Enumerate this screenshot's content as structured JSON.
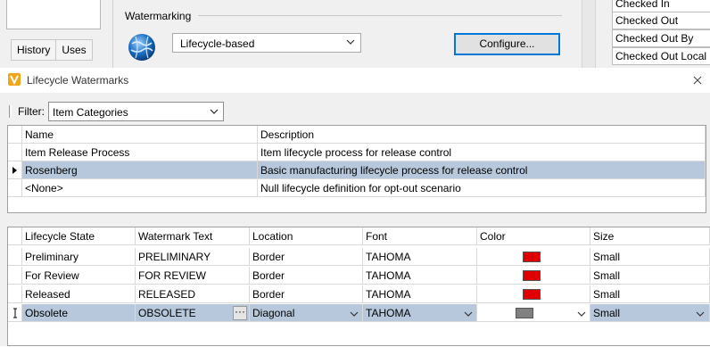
{
  "background": {
    "left_tabs": [
      "History",
      "Uses"
    ],
    "watermarking_label": "Watermarking",
    "lifecycle_select": "Lifecycle-based",
    "configure_button": "Configure...",
    "right_list": [
      "Checked In",
      "Checked Out",
      "Checked Out By",
      "Checked Out Local S"
    ]
  },
  "dialog": {
    "title": "Lifecycle Watermarks",
    "filter_label": "Filter:",
    "filter_value": "Item Categories",
    "lifecycles": {
      "columns": [
        "Name",
        "Description"
      ],
      "rows": [
        {
          "name": "Item Release Process",
          "description": "Item lifecycle process for release control"
        },
        {
          "name": "Rosenberg",
          "description": "Basic manufacturing lifecycle process for release control"
        },
        {
          "name": "<None>",
          "description": "Null lifecycle definition for opt-out scenario"
        }
      ],
      "selected_index": 1
    },
    "states": {
      "columns": [
        "Lifecycle State",
        "Watermark Text",
        "Location",
        "Font",
        "Color",
        "Size"
      ],
      "rows": [
        {
          "state": "Preliminary",
          "text": "PRELIMINARY",
          "location": "Border",
          "font": "TAHOMA",
          "color": "#e00000",
          "size": "Small"
        },
        {
          "state": "For Review",
          "text": "FOR REVIEW",
          "location": "Border",
          "font": "TAHOMA",
          "color": "#e00000",
          "size": "Small"
        },
        {
          "state": "Released",
          "text": "RELEASED",
          "location": "Border",
          "font": "TAHOMA",
          "color": "#e00000",
          "size": "Small"
        },
        {
          "state": "Obsolete",
          "text": "OBSOLETE",
          "location": "Diagonal",
          "font": "TAHOMA",
          "color": "#808080",
          "size": "Small"
        }
      ],
      "editing_index": 3,
      "ellipsis": "···"
    }
  },
  "icons": {
    "app": "vault-logo-icon",
    "close": "close-icon",
    "globe": "globe-icon",
    "dropdown": "chevron-down-icon",
    "row_pointer": "row-pointer-icon",
    "edit_cursor": "text-cursor-icon"
  }
}
